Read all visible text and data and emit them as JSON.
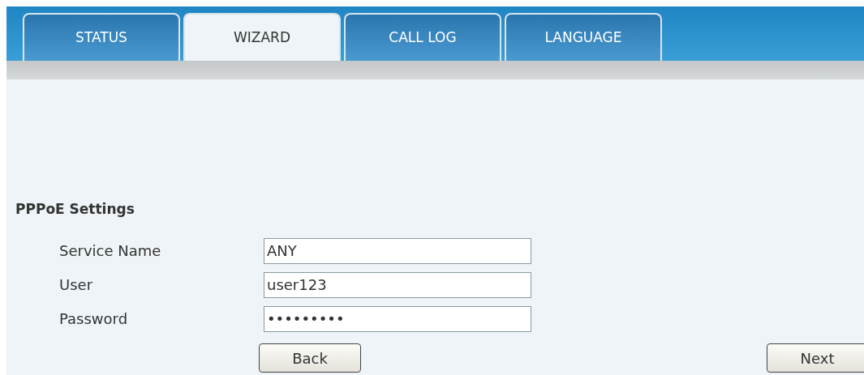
{
  "tabs": [
    {
      "label": "STATUS",
      "selected": false
    },
    {
      "label": "WIZARD",
      "selected": true
    },
    {
      "label": "CALL LOG",
      "selected": false
    },
    {
      "label": "LANGUAGE",
      "selected": false
    }
  ],
  "section": {
    "title": "PPPoE Settings"
  },
  "fields": [
    {
      "label": "Service Name",
      "value": "ANY"
    },
    {
      "label": "User",
      "value": "user123"
    },
    {
      "label": "Password",
      "value": "•••••••••"
    }
  ],
  "buttons": [
    "Back",
    "Next"
  ]
}
